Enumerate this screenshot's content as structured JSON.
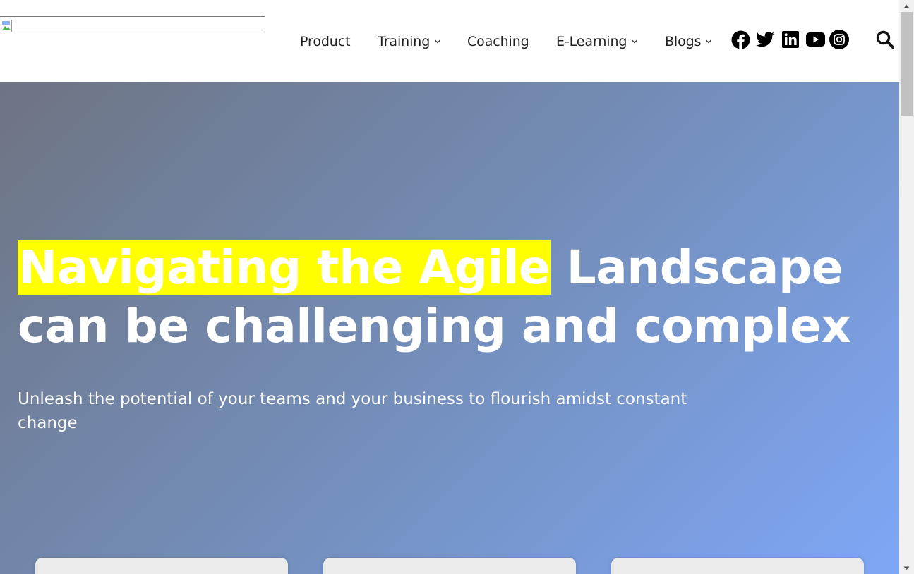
{
  "nav": {
    "items": [
      {
        "label": "Product",
        "has_dropdown": false
      },
      {
        "label": "Training",
        "has_dropdown": true
      },
      {
        "label": "Coaching",
        "has_dropdown": false
      },
      {
        "label": "E-Learning",
        "has_dropdown": true
      },
      {
        "label": "Blogs",
        "has_dropdown": true
      }
    ],
    "social_icons": [
      "facebook-icon",
      "twitter-icon",
      "linkedin-icon",
      "youtube-icon",
      "instagram-icon"
    ],
    "search_icon": "search-icon"
  },
  "hero": {
    "title_highlight": "Navigating the Agile",
    "title_rest_line1": " Landscape",
    "title_line2": "can be challenging and complex",
    "subtitle": "Unleash the potential of your teams and your business to flourish amidst constant change"
  },
  "colors": {
    "highlight": "#ffff00",
    "hero_gradient_start": "#6e7482",
    "hero_gradient_end": "#7ea7f6",
    "nav_text": "#1f1f1f"
  }
}
